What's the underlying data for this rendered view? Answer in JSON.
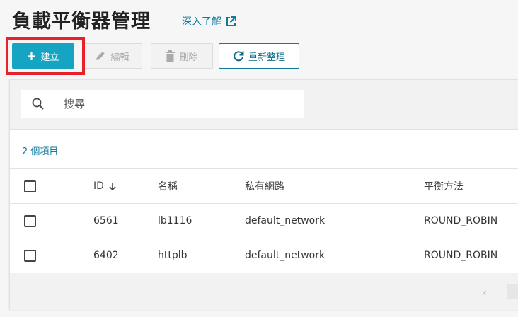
{
  "header": {
    "title": "負載平衡器管理",
    "learn_more": "深入了解"
  },
  "toolbar": {
    "create_label": "建立",
    "edit_label": "編輯",
    "delete_label": "刪除",
    "refresh_label": "重新整理"
  },
  "search": {
    "placeholder": "搜尋"
  },
  "list": {
    "count_label": "2 個項目",
    "columns": [
      "ID",
      "名稱",
      "私有網路",
      "平衡方法"
    ],
    "rows": [
      {
        "id": "6561",
        "name": "lb1116",
        "network": "default_network",
        "method": "ROUND_ROBIN"
      },
      {
        "id": "6402",
        "name": "httplb",
        "network": "default_network",
        "method": "ROUND_ROBIN"
      }
    ]
  },
  "pagination": {
    "prev_symbol": "‹"
  },
  "colors": {
    "accent": "#16a4c3",
    "link": "#0f7b9b",
    "highlight_border": "#e8202a"
  },
  "icons": {
    "create": "plus-icon",
    "edit": "pencil-icon",
    "delete": "trash-icon",
    "refresh": "refresh-icon",
    "learn_more": "external-link-icon",
    "search": "search-icon",
    "sort": "arrow-down-icon"
  }
}
